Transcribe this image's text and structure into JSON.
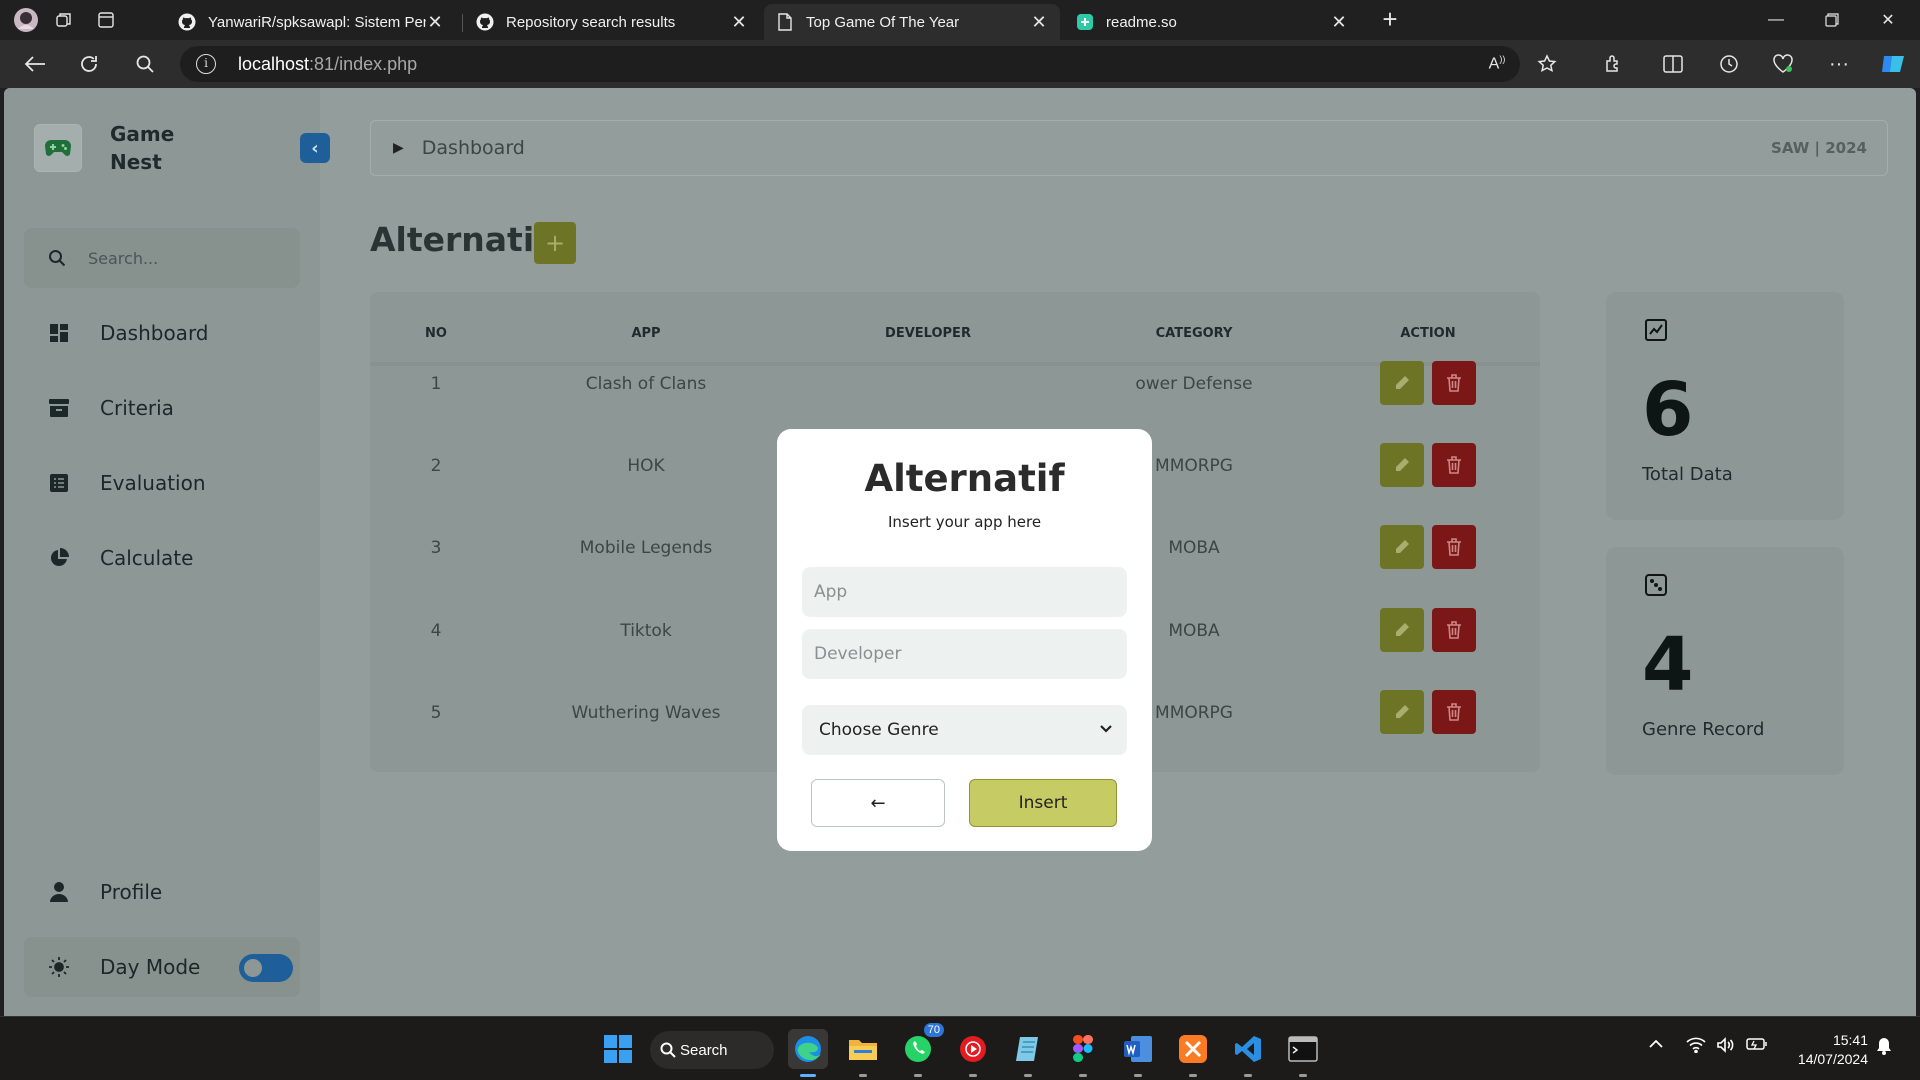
{
  "browser": {
    "tabs": [
      {
        "title": "YanwariR/spksawapl: Sistem Pend",
        "icon": "github-icon",
        "active": false
      },
      {
        "title": "Repository search results",
        "icon": "github-icon",
        "active": false
      },
      {
        "title": "Top Game Of The Year",
        "icon": "page-icon",
        "active": true
      },
      {
        "title": "readme.so",
        "icon": "readme-icon",
        "active": false
      }
    ],
    "url_host": "localhost",
    "url_path": ":81/index.php"
  },
  "sidebar": {
    "brand": "Game\nNest",
    "search_placeholder": "Search...",
    "items": [
      {
        "label": "Dashboard",
        "icon": "grid-icon"
      },
      {
        "label": "Criteria",
        "icon": "archive-icon"
      },
      {
        "label": "Evaluation",
        "icon": "list-icon"
      },
      {
        "label": "Calculate",
        "icon": "pie-chart-icon"
      }
    ],
    "profile": "Profile",
    "day_mode": "Day Mode"
  },
  "breadcrumb": {
    "label": "Dashboard",
    "right": "SAW | 2024"
  },
  "page": {
    "title": "Alternatif",
    "add_label": "+"
  },
  "table": {
    "headers": [
      "NO",
      "APP",
      "DEVELOPER",
      "CATEGORY",
      "ACTION"
    ],
    "rows": [
      {
        "no": "1",
        "app": "Clash of Clans",
        "category": "ower Defense"
      },
      {
        "no": "2",
        "app": "HOK",
        "category": "MMORPG"
      },
      {
        "no": "3",
        "app": "Mobile Legends",
        "category": "MOBA"
      },
      {
        "no": "4",
        "app": "Tiktok",
        "category": "MOBA"
      },
      {
        "no": "5",
        "app": "Wuthering Waves",
        "category": "MMORPG"
      }
    ]
  },
  "stats": [
    {
      "value": "6",
      "label": "Total Data",
      "icon": "trend-chart-icon"
    },
    {
      "value": "4",
      "label": "Genre Record",
      "icon": "dice-icon"
    }
  ],
  "modal": {
    "title": "Alternatif",
    "subtitle": "Insert your app here",
    "app_placeholder": "App",
    "developer_placeholder": "Developer",
    "genre_selected": "Choose Genre",
    "back_label": "←",
    "insert_label": "Insert"
  },
  "taskbar": {
    "search_label": "Search",
    "whatsapp_badge": "70",
    "time": "15:41",
    "date": "14/07/2024"
  }
}
